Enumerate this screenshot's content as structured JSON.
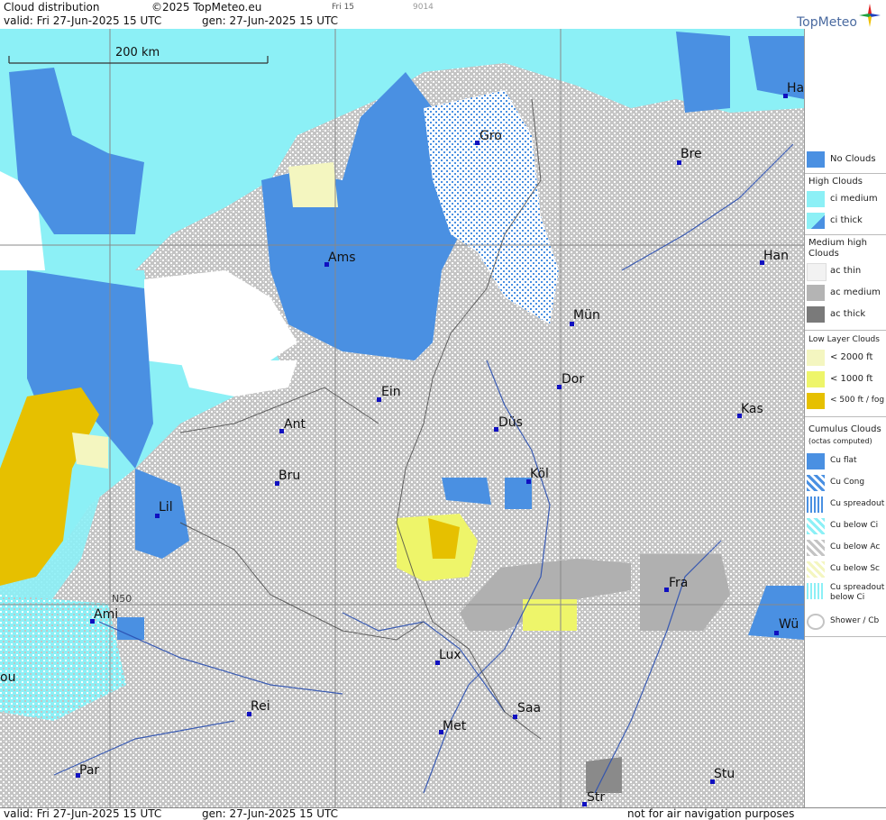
{
  "header": {
    "title": "Cloud distribution",
    "copyright": "©2025 TopMeteo.eu",
    "run_tag": "Fri 15",
    "code": "9014",
    "valid": "valid:  Fri  27-Jun-2025  15 UTC",
    "gen": "gen: 27-Jun-2025 15 UTC",
    "brand": "TopMeteo"
  },
  "footer": {
    "valid": "valid:  Fri  27-Jun-2025  15 UTC",
    "gen": "gen: 27-Jun-2025 15 UTC",
    "note": "not for air navigation purposes"
  },
  "map": {
    "scale_label": "200 km",
    "lat_label": "N50",
    "cities": [
      {
        "name": "Ha",
        "id": "hamburg"
      },
      {
        "name": "Gro",
        "id": "groningen"
      },
      {
        "name": "Bre",
        "id": "bremen"
      },
      {
        "name": "Ams",
        "id": "amsterdam"
      },
      {
        "name": "Han",
        "id": "hannover"
      },
      {
        "name": "Mün",
        "id": "muenster"
      },
      {
        "name": "Dor",
        "id": "dortmund"
      },
      {
        "name": "Ein",
        "id": "eindhoven"
      },
      {
        "name": "Ant",
        "id": "antwerpen"
      },
      {
        "name": "Düs",
        "id": "duesseldorf"
      },
      {
        "name": "Kas",
        "id": "kassel"
      },
      {
        "name": "Bru",
        "id": "brussels"
      },
      {
        "name": "Köl",
        "id": "koeln"
      },
      {
        "name": "Lil",
        "id": "lille"
      },
      {
        "name": "Fra",
        "id": "frankfurt"
      },
      {
        "name": "Ami",
        "id": "amiens"
      },
      {
        "name": "Wü",
        "id": "wuerzburg"
      },
      {
        "name": "ou",
        "id": "rouen-partial"
      },
      {
        "name": "Lux",
        "id": "luxembourg"
      },
      {
        "name": "Rei",
        "id": "reims"
      },
      {
        "name": "Saa",
        "id": "saarbruecken"
      },
      {
        "name": "Met",
        "id": "metz"
      },
      {
        "name": "Par",
        "id": "paris"
      },
      {
        "name": "Stu",
        "id": "stuttgart"
      },
      {
        "name": "Str",
        "id": "strasbourg"
      }
    ]
  },
  "legend": {
    "no_clouds": "No Clouds",
    "high_clouds_head": "High Clouds",
    "ci_medium": "ci medium",
    "ci_thick": "ci thick",
    "medium_head": "Medium high Clouds",
    "ac_thin": "ac thin",
    "ac_medium": "ac medium",
    "ac_thick": "ac thick",
    "low_head": "Low Layer Clouds",
    "lt2000": "< 2000 ft",
    "lt1000": "< 1000 ft",
    "lt500": "< 500 ft / fog",
    "cumulus_head": "Cumulus Clouds",
    "cumulus_sub": "(octas computed)",
    "cu_flat": "Cu flat",
    "cu_cong": "Cu Cong",
    "cu_spreadout": "Cu spreadout",
    "cu_below_ci": "Cu below Ci",
    "cu_below_ac": "Cu below Ac",
    "cu_below_sc": "Cu below Sc",
    "cu_spreadout_below_ci_1": "Cu spreadout",
    "cu_spreadout_below_ci_2": "below Ci",
    "shower_cb": "Shower / Cb"
  },
  "colors": {
    "no_clouds": "#4a90e2",
    "ci_medium": "#8cf0f6",
    "ac_medium": "#b4b4b4",
    "ac_thick": "#7a7a7a",
    "low_lt2000": "#f4f6c0",
    "low_lt1000": "#eef56a",
    "low_fog": "#e6c000"
  }
}
